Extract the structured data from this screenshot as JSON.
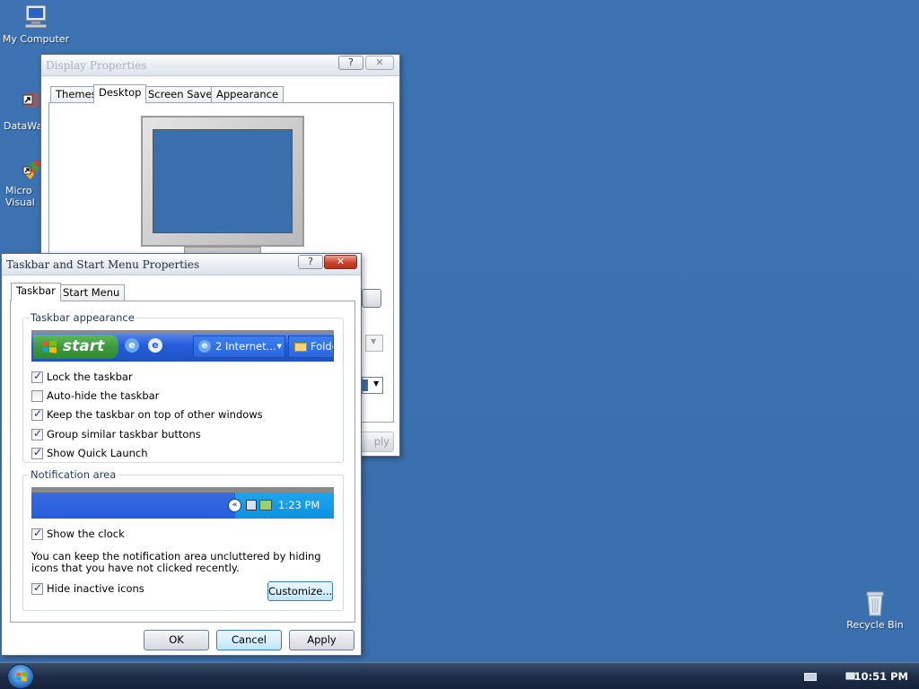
{
  "desktop": {
    "icons": [
      {
        "label": "My Computer"
      },
      {
        "label": "DataWa"
      },
      {
        "label": "Micro\nVisual"
      },
      {
        "label": "Recycle Bin"
      }
    ]
  },
  "display_props": {
    "title": "Display Properties",
    "help_btn": "?",
    "close_btn": "✕",
    "tabs": [
      "Themes",
      "Desktop",
      "Screen Saver",
      "Appearance"
    ],
    "active_tab": "Desktop",
    "apply_partial": "ply"
  },
  "taskbar_props": {
    "title": "Taskbar and Start Menu Properties",
    "help_btn": "?",
    "close_btn": "✕",
    "tabs": [
      "Taskbar",
      "Start Menu"
    ],
    "active_tab": "Taskbar",
    "appearance_group": "Taskbar appearance",
    "preview": {
      "start": "start",
      "btn1": "2 Internet...",
      "btn2": "Folde"
    },
    "options": [
      {
        "label": "Lock the taskbar",
        "checked": true
      },
      {
        "label": "Auto-hide the taskbar",
        "checked": false
      },
      {
        "label": "Keep the taskbar on top of other windows",
        "checked": true
      },
      {
        "label": "Group similar taskbar buttons",
        "checked": true
      },
      {
        "label": "Show Quick Launch",
        "checked": true
      }
    ],
    "notification_group": "Notification area",
    "notif_preview_time": "1:23 PM",
    "show_clock": {
      "label": "Show the clock",
      "checked": true
    },
    "info_text": "You can keep the notification area uncluttered by hiding icons that you have not clicked recently.",
    "hide_inactive": {
      "label": "Hide inactive icons",
      "checked": true
    },
    "customize_btn": "Customize...",
    "ok_btn": "OK",
    "cancel_btn": "Cancel",
    "apply_btn": "Apply"
  },
  "taskbar": {
    "clock": "10:51 PM"
  },
  "colors": {
    "desktop": "#3a6fad",
    "xp_blue": "#245edc",
    "start_green": "#3c9a3c"
  }
}
